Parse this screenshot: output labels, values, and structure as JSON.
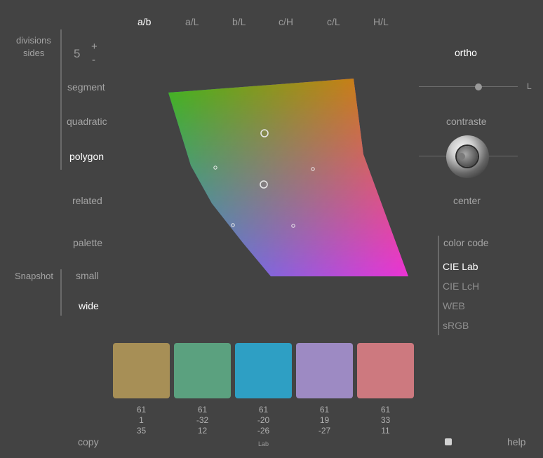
{
  "tabs": [
    "a/b",
    "a/L",
    "b/L",
    "c/H",
    "c/L",
    "H/L"
  ],
  "active_tab": "a/b",
  "left": {
    "divisions_label": "divisions",
    "sides_label": "sides",
    "count": "5",
    "plus": "+",
    "minus": "-",
    "shapes": [
      "segment",
      "quadratic",
      "polygon"
    ],
    "related": "related",
    "palette": "palette",
    "snapshot_label": "Snapshot",
    "snapshot_options": [
      "small",
      "wide"
    ],
    "copy": "copy"
  },
  "right": {
    "ortho": "ortho",
    "slider_axis": "L",
    "slider_value_fraction": 0.61,
    "contraste": "contraste",
    "center": "center",
    "color_code_label": "color code",
    "color_codes": [
      "CIE Lab",
      "CIE LcH",
      "WEB",
      "sRGB"
    ],
    "help": "help"
  },
  "swatches": [
    {
      "color": "#a78f56",
      "values": [
        "61",
        "1",
        "35"
      ]
    },
    {
      "color": "#5ba17f",
      "values": [
        "61",
        "-32",
        "12"
      ]
    },
    {
      "color": "#2e9fc4",
      "values": [
        "61",
        "-20",
        "-26"
      ]
    },
    {
      "color": "#9d8ac3",
      "values": [
        "61",
        "19",
        "-27"
      ]
    },
    {
      "color": "#cd797f",
      "values": [
        "61",
        "33",
        "11"
      ]
    }
  ],
  "values_unit": "Lab",
  "colors": {
    "background": "#434343",
    "text": "#a8a8a8",
    "active_text": "#ffffff"
  }
}
